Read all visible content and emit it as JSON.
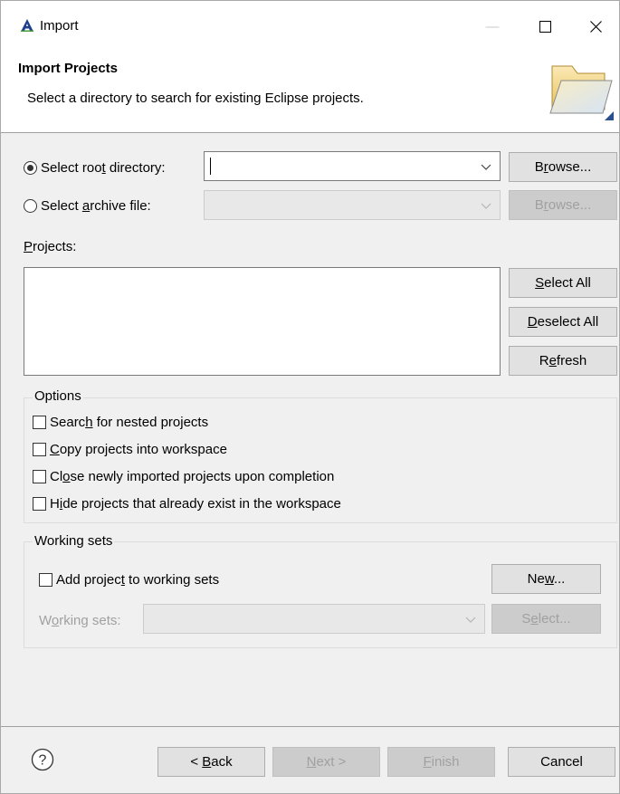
{
  "window": {
    "title": "Import",
    "minimize_glyph": "—",
    "maximize_glyph": "☐",
    "close_glyph": "✕"
  },
  "banner": {
    "title": "Import Projects",
    "description": "Select a directory to search for existing Eclipse projects."
  },
  "source": {
    "root_dir": {
      "label_a": "Select roo",
      "label_u": "t",
      "label_b": " directory:",
      "value": "",
      "browse_a": "B",
      "browse_u": "r",
      "browse_b": "owse...",
      "selected": true
    },
    "archive": {
      "label_a": "Select ",
      "label_u": "a",
      "label_b": "rchive file:",
      "value": "",
      "browse_a": "B",
      "browse_u": "r",
      "browse_b": "owse...",
      "selected": false
    }
  },
  "projects": {
    "label_u": "P",
    "label_b": "rojects:",
    "select_all_u": "S",
    "select_all_b": "elect All",
    "deselect_all_u": "D",
    "deselect_all_b": "eselect All",
    "refresh_a": "R",
    "refresh_u": "e",
    "refresh_b": "fresh",
    "items": []
  },
  "options": {
    "title": "Options",
    "nested": {
      "a": "Searc",
      "u": "h",
      "b": " for nested projects",
      "checked": false
    },
    "copy": {
      "a": "",
      "u": "C",
      "b": "opy projects into workspace",
      "checked": false
    },
    "close": {
      "a": "Cl",
      "u": "o",
      "b": "se newly imported projects upon completion",
      "checked": false
    },
    "hide": {
      "a": "H",
      "u": "i",
      "b": "de projects that already exist in the workspace",
      "checked": false
    }
  },
  "working_sets": {
    "title": "Working sets",
    "add": {
      "a": "Add projec",
      "u": "t",
      "b": " to working sets",
      "checked": false
    },
    "new_a": "Ne",
    "new_u": "w",
    "new_b": "...",
    "sets_label_a": "W",
    "sets_label_u": "o",
    "sets_label_b": "rking sets:",
    "select_a": "S",
    "select_u": "e",
    "select_b": "lect...",
    "value": ""
  },
  "footer": {
    "help_glyph": "?",
    "back_a": "< ",
    "back_u": "B",
    "back_b": "ack",
    "next_u": "N",
    "next_b": "ext >",
    "finish_u": "F",
    "finish_b": "inish",
    "cancel": "Cancel"
  },
  "colors": {
    "dialog_bg": "#f0f0f0",
    "button_bg": "#e1e1e1",
    "disabled_text": "#a0a0a0",
    "app_icon_blue": "#1e3f8c",
    "folder_yellow": "#f5d78a"
  }
}
